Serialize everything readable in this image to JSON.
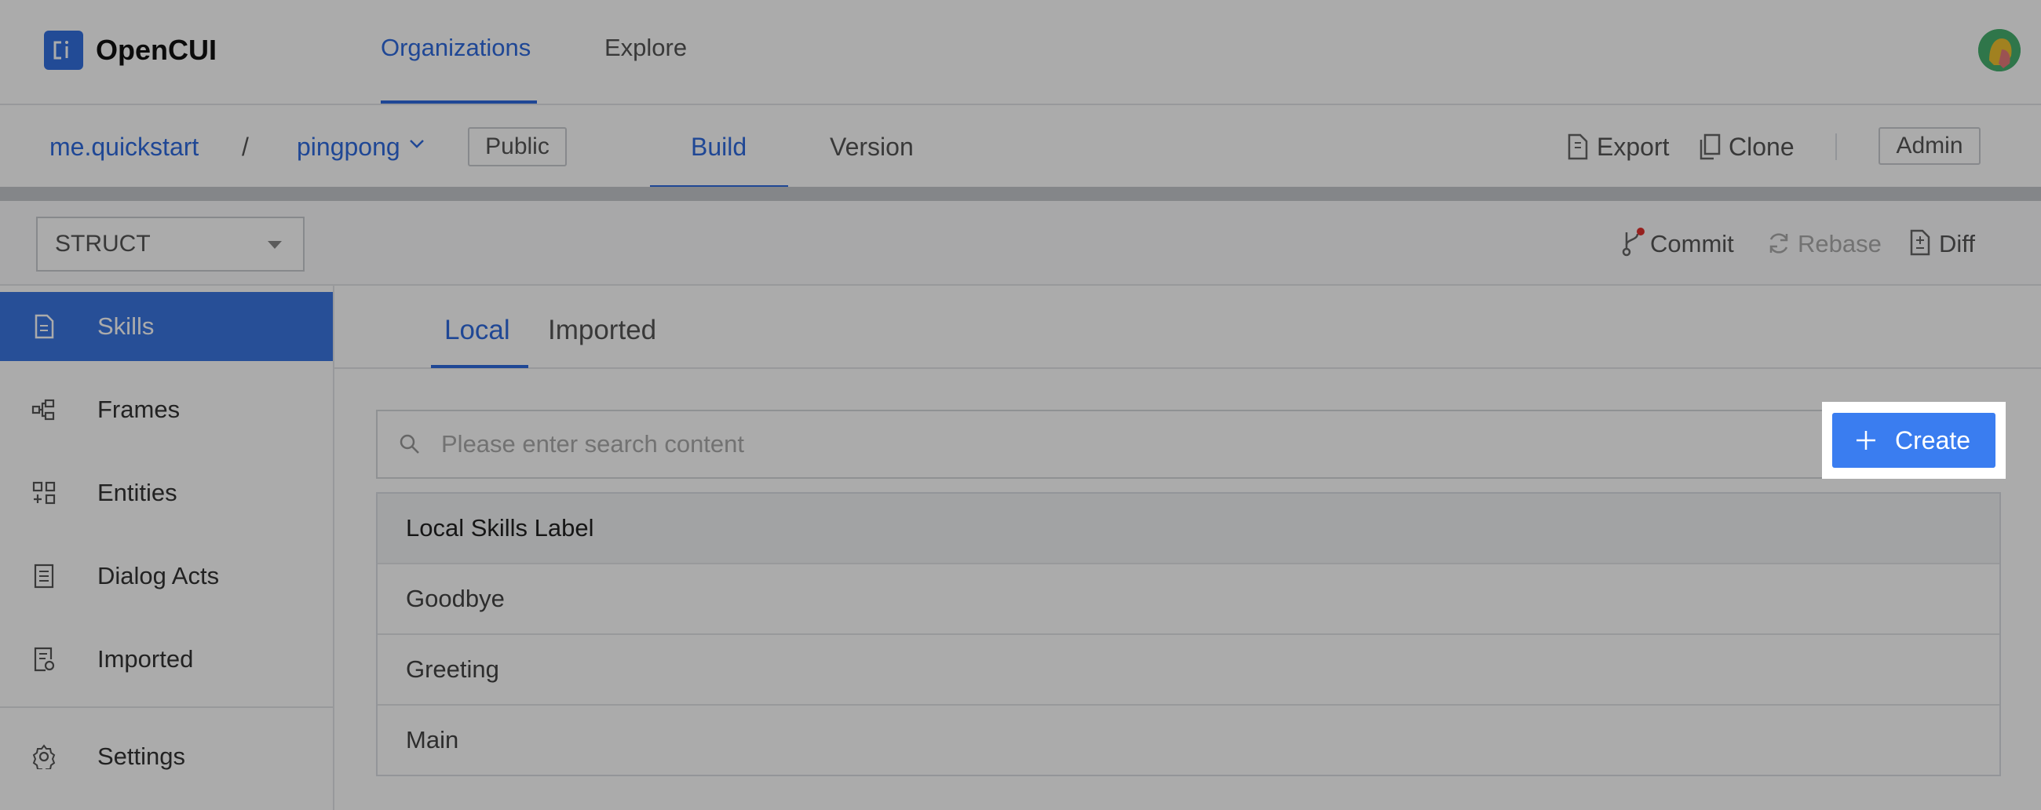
{
  "app": {
    "name": "OpenCUI",
    "logo_glyph": "CI",
    "accent_color": "#2f6bde"
  },
  "topnav": {
    "items": [
      {
        "label": "Organizations",
        "active": true
      },
      {
        "label": "Explore",
        "active": false
      }
    ]
  },
  "project": {
    "org": "me.quickstart",
    "separator": "/",
    "name": "pingpong",
    "visibility": "Public",
    "tabs": [
      {
        "label": "Build",
        "active": true
      },
      {
        "label": "Version",
        "active": false
      }
    ],
    "actions": {
      "export": "Export",
      "clone": "Clone",
      "admin": "Admin"
    }
  },
  "toolbar": {
    "select_value": "STRUCT",
    "commit": "Commit",
    "rebase": "Rebase",
    "diff": "Diff"
  },
  "sidebar": {
    "items": [
      {
        "label": "Skills",
        "icon": "document-icon",
        "active": true
      },
      {
        "label": "Frames",
        "icon": "frames-icon",
        "active": false
      },
      {
        "label": "Entities",
        "icon": "entities-icon",
        "active": false
      },
      {
        "label": "Dialog Acts",
        "icon": "dialog-acts-icon",
        "active": false
      },
      {
        "label": "Imported",
        "icon": "imported-icon",
        "active": false
      }
    ],
    "settings": {
      "label": "Settings",
      "icon": "gear-icon"
    }
  },
  "main": {
    "tabs": [
      {
        "label": "Local",
        "active": true
      },
      {
        "label": "Imported",
        "active": false
      }
    ],
    "search": {
      "placeholder": "Please enter search content",
      "value": ""
    },
    "create_label": "Create",
    "table": {
      "header": "Local Skills Label",
      "rows": [
        "Goodbye",
        "Greeting",
        "Main"
      ]
    }
  }
}
